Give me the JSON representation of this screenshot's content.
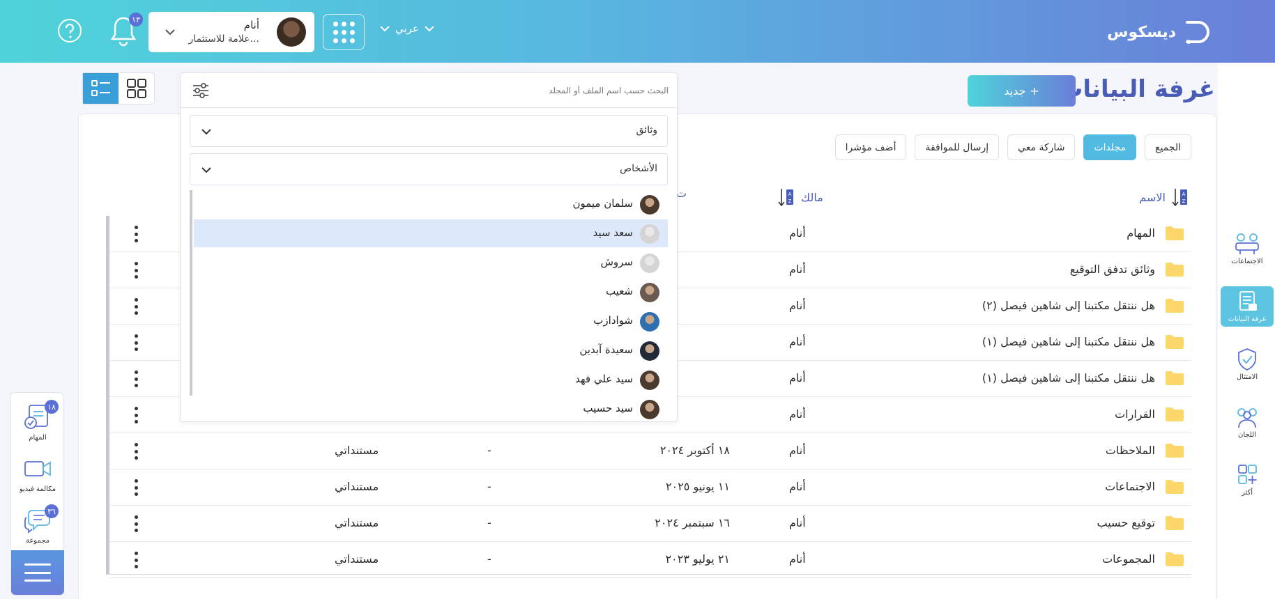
{
  "app": {
    "name": "ديسكوس"
  },
  "header": {
    "language": "عربي",
    "user_name": "أنام",
    "user_org": "علامة للاستثمار...",
    "notifications_count": "١٣"
  },
  "page": {
    "title": "غرفة البيانات",
    "new_button": "جديد"
  },
  "nav": {
    "items": [
      {
        "label": "الاجتماعات",
        "icon": "meetings-icon"
      },
      {
        "label": "غرفة البيانات",
        "icon": "data-room-icon"
      },
      {
        "label": "الامتثال",
        "icon": "compliance-icon"
      },
      {
        "label": "اللجان",
        "icon": "committees-icon"
      },
      {
        "label": "أكثر",
        "icon": "more-icon"
      }
    ]
  },
  "filters": [
    "الجميع",
    "مجلدات",
    "شاركة معي",
    "إرسال للموافقة",
    "أضف مؤشرا"
  ],
  "active_filter": "مجلدات",
  "search": {
    "placeholder": "البحث حسب اسم الملف أو المجلد",
    "type_value": "وثائق",
    "people_value": "الأشخاص",
    "people": [
      {
        "name": "سلمان ميمون",
        "avatar": "photo"
      },
      {
        "name": "سعد سيد",
        "avatar": "placeholder"
      },
      {
        "name": "سروش",
        "avatar": "placeholder"
      },
      {
        "name": "شعيب",
        "avatar": "photo"
      },
      {
        "name": "شوادازب",
        "avatar": "photo"
      },
      {
        "name": "سعيدة آبدين",
        "avatar": "photo"
      },
      {
        "name": "سيد علي فهد",
        "avatar": "photo"
      },
      {
        "name": "سيد حسيب",
        "avatar": "photo"
      }
    ],
    "highlighted": "سعد سيد"
  },
  "table": {
    "headers": {
      "name": "الاسم",
      "owner": "مالك",
      "date": "ت"
    },
    "rows": [
      {
        "name": "المهام",
        "owner": "أنام",
        "date": "",
        "dash": "",
        "location": ""
      },
      {
        "name": "وثائق تدفق التوقيع",
        "owner": "أنام",
        "date": "",
        "dash": "",
        "location": ""
      },
      {
        "name": "هل ننتقل مكتبنا إلى شاهين فيصل (٢)",
        "owner": "أنام",
        "date": "",
        "dash": "",
        "location": ""
      },
      {
        "name": "هل ننتقل مكتبنا إلى شاهين فيصل (١)",
        "owner": "أنام",
        "date": "",
        "dash": "",
        "location": ""
      },
      {
        "name": "هل ننتقل مكتبنا إلى شاهين فيصل (١)",
        "owner": "أنام",
        "date": "",
        "dash": "",
        "location": ""
      },
      {
        "name": "القرارات",
        "owner": "أنام",
        "date": "",
        "dash": "",
        "location": ""
      },
      {
        "name": "الملاحظات",
        "owner": "أنام",
        "date": "١٨ أكتوبر ٢٠٢٤",
        "dash": "-",
        "location": "مستنداتي"
      },
      {
        "name": "الاجتماعات",
        "owner": "أنام",
        "date": "١١ يونيو ٢٠٢٥",
        "dash": "-",
        "location": "مستنداتي"
      },
      {
        "name": "توقيع حسيب",
        "owner": "أنام",
        "date": "١٦ سبتمبر ٢٠٢٤",
        "dash": "-",
        "location": "مستنداتي"
      },
      {
        "name": "المجموعات",
        "owner": "أنام",
        "date": "٢١ يوليو ٢٠٢٣",
        "dash": "-",
        "location": "مستنداتي"
      }
    ]
  },
  "dock": {
    "tasks_label": "المهام",
    "tasks_badge": "١٨",
    "video_label": "مكالمة فيديو",
    "group_label": "مجموعة",
    "group_badge": "٣٦"
  },
  "colors": {
    "accent": "#52b9e1",
    "title": "#4a5db6",
    "folder": "#fcd86a"
  }
}
